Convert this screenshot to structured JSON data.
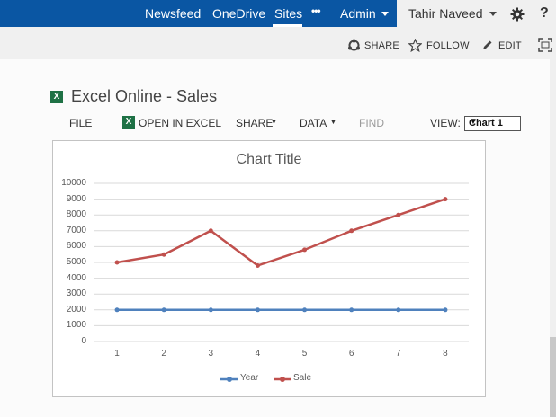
{
  "suite_nav": {
    "items": [
      "Newsfeed",
      "OneDrive",
      "Sites",
      "•••",
      "Admin"
    ]
  },
  "user": {
    "name": "Tahir Naveed"
  },
  "icons": {
    "settings": "gear-icon",
    "help": "question-icon"
  },
  "action_bar": {
    "share": "SHARE",
    "follow": "FOLLOW",
    "edit": "EDIT"
  },
  "document": {
    "title": "Excel Online - Sales"
  },
  "ribbon": {
    "file": "FILE",
    "open_in_excel": "OPEN IN EXCEL",
    "share": "SHARE",
    "data": "DATA",
    "find": "FIND",
    "view_label": "VIEW:",
    "view_value": "Chart 1"
  },
  "colors": {
    "suite_bar": "#0a56a3",
    "year_series": "#4f81bd",
    "sale_series": "#c0504d"
  },
  "chart_data": {
    "type": "line",
    "title": "Chart Title",
    "x": [
      1,
      2,
      3,
      4,
      5,
      6,
      7,
      8
    ],
    "x_tick_labels": [
      "1",
      "2",
      "3",
      "4",
      "5",
      "6",
      "7",
      "8"
    ],
    "y_tick_labels": [
      "10000",
      "9000",
      "8000",
      "7000",
      "6000",
      "5000",
      "4000",
      "3000",
      "2000",
      "1000",
      "0"
    ],
    "ylim": [
      0,
      10000
    ],
    "grid": true,
    "legend_position": "bottom",
    "series": [
      {
        "name": "Year",
        "color": "#4f81bd",
        "values": [
          2000,
          2000,
          2000,
          2000,
          2000,
          2000,
          2000,
          2000
        ]
      },
      {
        "name": "Sale",
        "color": "#c0504d",
        "values": [
          5000,
          5500,
          7000,
          4800,
          5800,
          7000,
          8000,
          9000
        ]
      }
    ]
  }
}
